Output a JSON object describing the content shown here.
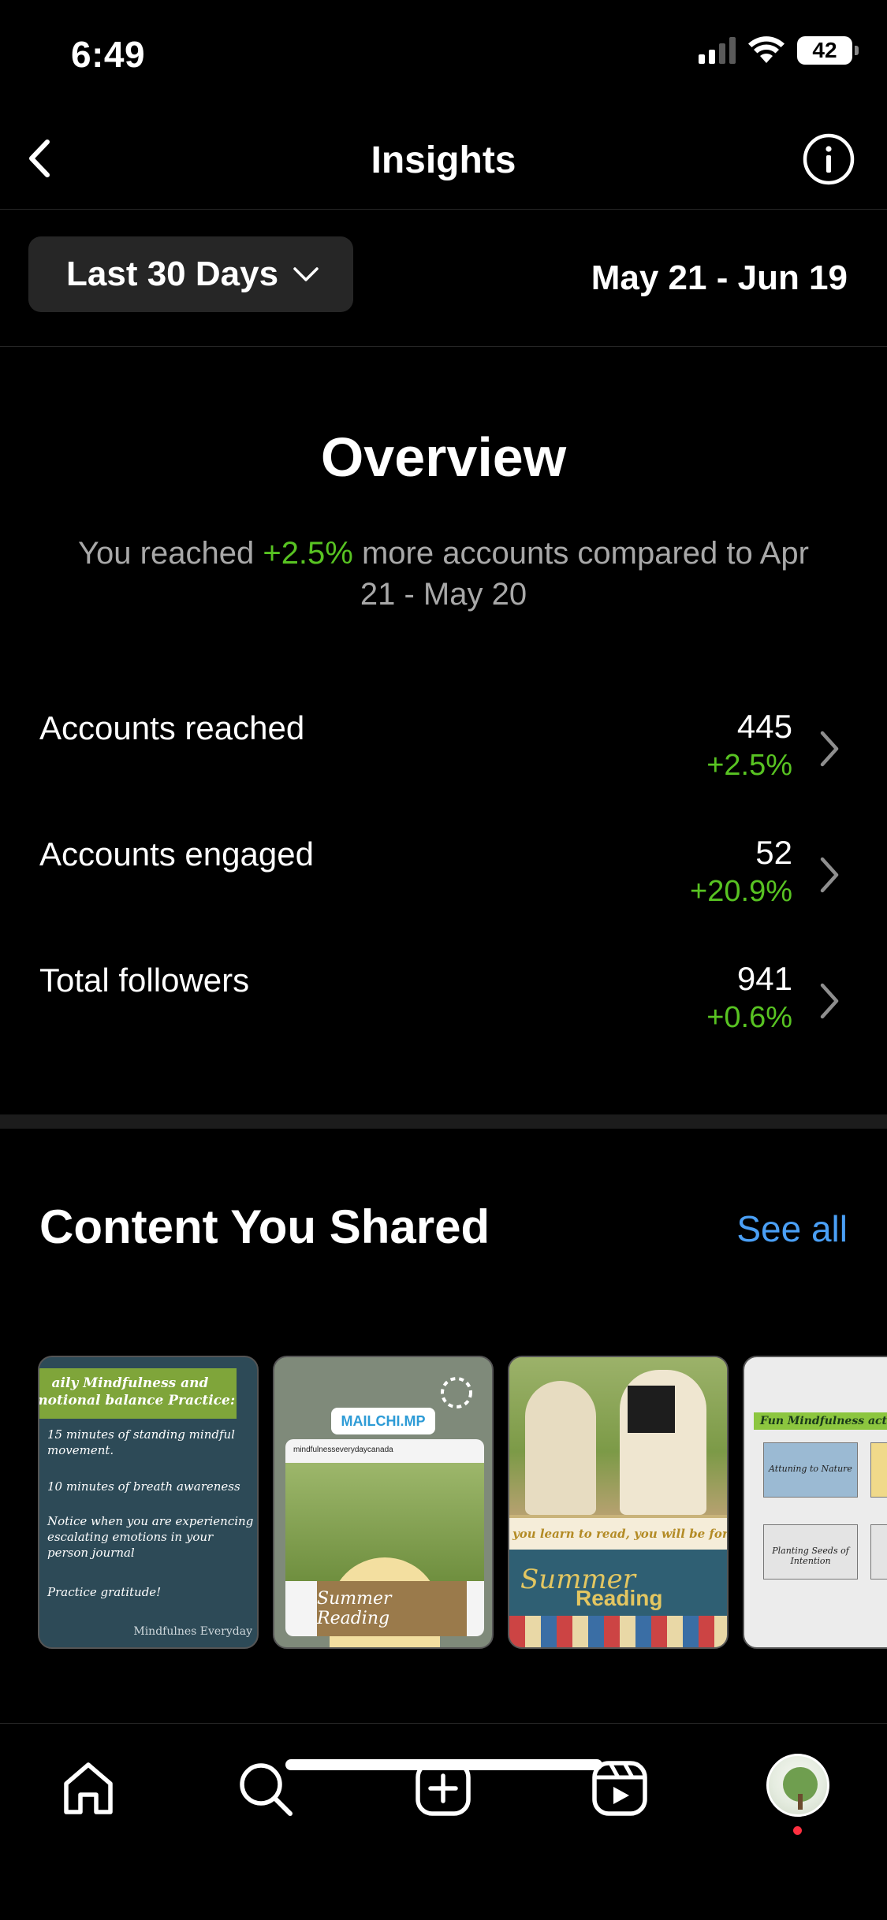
{
  "status_bar": {
    "time": "6:49",
    "battery": "42"
  },
  "nav": {
    "title": "Insights"
  },
  "filter": {
    "range_label": "Last 30 Days",
    "date_range": "May 21 - Jun 19"
  },
  "overview": {
    "title": "Overview",
    "desc_prefix": "You reached ",
    "desc_highlight": "+2.5%",
    "desc_suffix": " more accounts compared to Apr 21 - May 20",
    "metrics": [
      {
        "label": "Accounts reached",
        "value": "445",
        "change": "+2.5%"
      },
      {
        "label": "Accounts engaged",
        "value": "52",
        "change": "+20.9%"
      },
      {
        "label": "Total followers",
        "value": "941",
        "change": "+0.6%"
      }
    ]
  },
  "content": {
    "title": "Content You Shared",
    "see_all": "See all",
    "thumbs": [
      {
        "header": "aily Mindfulness and emotional balance Practice:",
        "lines": [
          "15 minutes of standing mindful movement.",
          "10 minutes of breath awareness",
          "Notice when you are experiencing escalating emotions in your person journal",
          "Practice gratitude!"
        ],
        "brand": "Mindfulnes Everyday"
      },
      {
        "chip": "MAILCHI.MP",
        "card_head": "mindfulnesseverydaycanada",
        "book_text": "Summer Reading"
      },
      {
        "banner": "you learn to read, you will be forever",
        "summer": "Summer",
        "reading": "Reading"
      },
      {
        "header": "Fun Mindfulness activities",
        "note1": "Attuning to Nature",
        "note3": "Planting Seeds of Intention"
      }
    ]
  },
  "colors": {
    "background": "#000000",
    "positive": "#58c322",
    "link": "#4a9ff5",
    "notification": "#ff3040"
  },
  "icons": {
    "back": "chevron-left-icon",
    "info": "info-icon",
    "home": "home-icon",
    "search": "search-icon",
    "create": "plus-square-icon",
    "reels": "reels-icon"
  }
}
